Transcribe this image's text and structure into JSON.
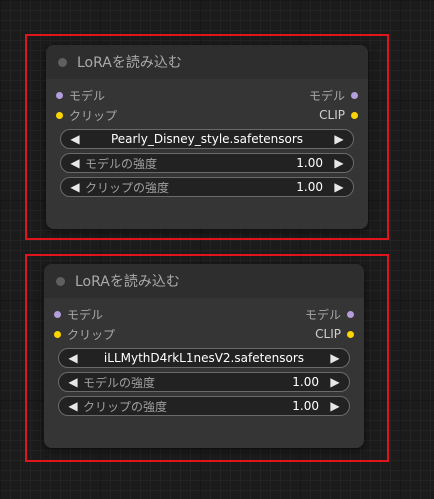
{
  "colors": {
    "highlight": "#e0151b",
    "model_slot": "#b39ddb",
    "clip_slot": "#ffd500"
  },
  "nodes": [
    {
      "title": "LoRAを読み込む",
      "input_model": "モデル",
      "output_model": "モデル",
      "input_clip": "クリップ",
      "output_clip": "CLIP",
      "lora_name": "Pearly_Disney_style.safetensors",
      "strength_model_label": "モデルの強度",
      "strength_model_value": "1.00",
      "strength_clip_label": "クリップの強度",
      "strength_clip_value": "1.00"
    },
    {
      "title": "LoRAを読み込む",
      "input_model": "モデル",
      "output_model": "モデル",
      "input_clip": "クリップ",
      "output_clip": "CLIP",
      "lora_name": "iLLMythD4rkL1nesV2.safetensors",
      "strength_model_label": "モデルの強度",
      "strength_model_value": "1.00",
      "strength_clip_label": "クリップの強度",
      "strength_clip_value": "1.00"
    }
  ]
}
